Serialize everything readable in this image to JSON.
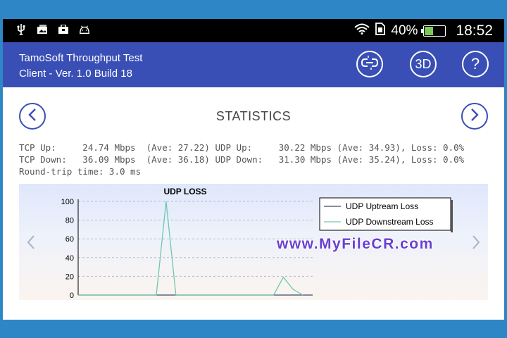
{
  "status_bar": {
    "battery_text": "40%",
    "battery_level": 0.4,
    "time": "18:52",
    "notification_icons": [
      "usb-icon",
      "photo-icon",
      "briefcase-icon",
      "android-icon"
    ],
    "system_icons": [
      "wifi-icon",
      "sim-icon",
      "battery-icon"
    ]
  },
  "app_bar": {
    "title": "TamoSoft Throughput Test",
    "subtitle": "Client - Ver. 1.0 Build 18",
    "btn_3d_label": "3D",
    "btn_help_label": "?"
  },
  "statistics": {
    "title": "STATISTICS",
    "lines": [
      "TCP Up:     24.74 Mbps  (Ave: 27.22) UDP Up:     30.22 Mbps (Ave: 34.93), Loss: 0.0%",
      "TCP Down:   36.09 Mbps  (Ave: 36.18) UDP Down:   31.30 Mbps (Ave: 35.24), Loss: 0.0%",
      "Round-trip time: 3.0 ms"
    ]
  },
  "watermark": "www.MyFileCR.com",
  "chart_data": {
    "type": "line",
    "title": "UDP LOSS",
    "xlabel": "",
    "ylabel": "",
    "ylim": [
      0,
      100
    ],
    "yticks": [
      0,
      20,
      40,
      60,
      80,
      100
    ],
    "xlim": [
      0,
      24
    ],
    "grid": true,
    "legend_position": "top-right",
    "series": [
      {
        "name": "UDP Uptream Loss",
        "color": "#3b4a6b",
        "x": [
          0,
          24
        ],
        "values": [
          0,
          0
        ]
      },
      {
        "name": "UDP Downstream Loss",
        "color": "#6fc7b2",
        "x": [
          0,
          8,
          9,
          10,
          20,
          21,
          22,
          23
        ],
        "values": [
          0,
          0,
          100,
          0,
          0,
          19,
          6,
          0
        ]
      }
    ]
  }
}
